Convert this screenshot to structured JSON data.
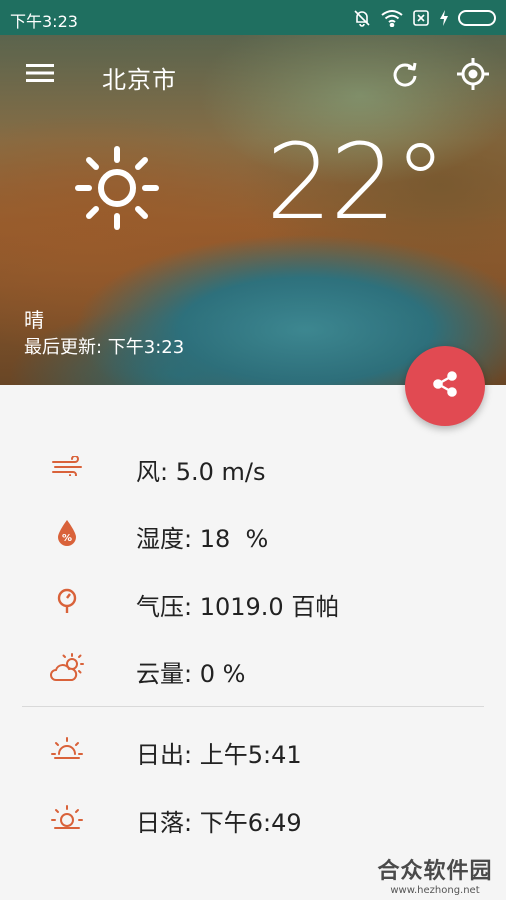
{
  "status_bar": {
    "time": "下午3:23",
    "icons": [
      "notification-muted-icon",
      "wifi-icon",
      "sim-off-icon",
      "charging-icon",
      "battery-icon"
    ],
    "battery_color": "#5ad15a",
    "background": "#1f6f60"
  },
  "header": {
    "city": "北京市",
    "menu_icon": "hamburger-menu-icon",
    "refresh_icon": "refresh-icon",
    "locate_icon": "gps-locate-icon"
  },
  "weather": {
    "icon": "sun-icon",
    "temperature": "22°",
    "condition": "晴",
    "last_updated": "最后更新: 下午3:23"
  },
  "share": {
    "icon": "share-icon",
    "color": "#e14a52"
  },
  "details": {
    "accent_color": "#d9623a",
    "wind": "风: 5.0 m/s",
    "humidity": "湿度: 18  %",
    "pressure": "气压: 1019.0 百帕",
    "cloudiness": "云量: 0 %",
    "sunrise": "日出: 上午5:41",
    "sunset": "日落: 下午6:49"
  },
  "watermark": {
    "name": "合众软件园",
    "url": "www.hezhong.net"
  }
}
